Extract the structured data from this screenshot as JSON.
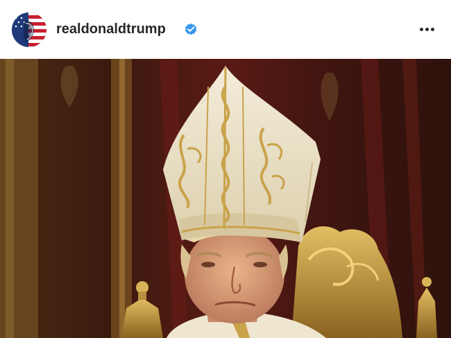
{
  "post": {
    "username": "realdonaldtrump",
    "verified": true,
    "avatar_icon": "american-flag-portrait-avatar",
    "more_icon": "more-horizontal-icon",
    "image_description_icon": "pope-portrait-image"
  },
  "colors": {
    "verified_badge": "#3897f0",
    "text": "#262626",
    "background": "#ffffff",
    "gold": "#c9a24a",
    "mitre": "#efe6cf"
  }
}
